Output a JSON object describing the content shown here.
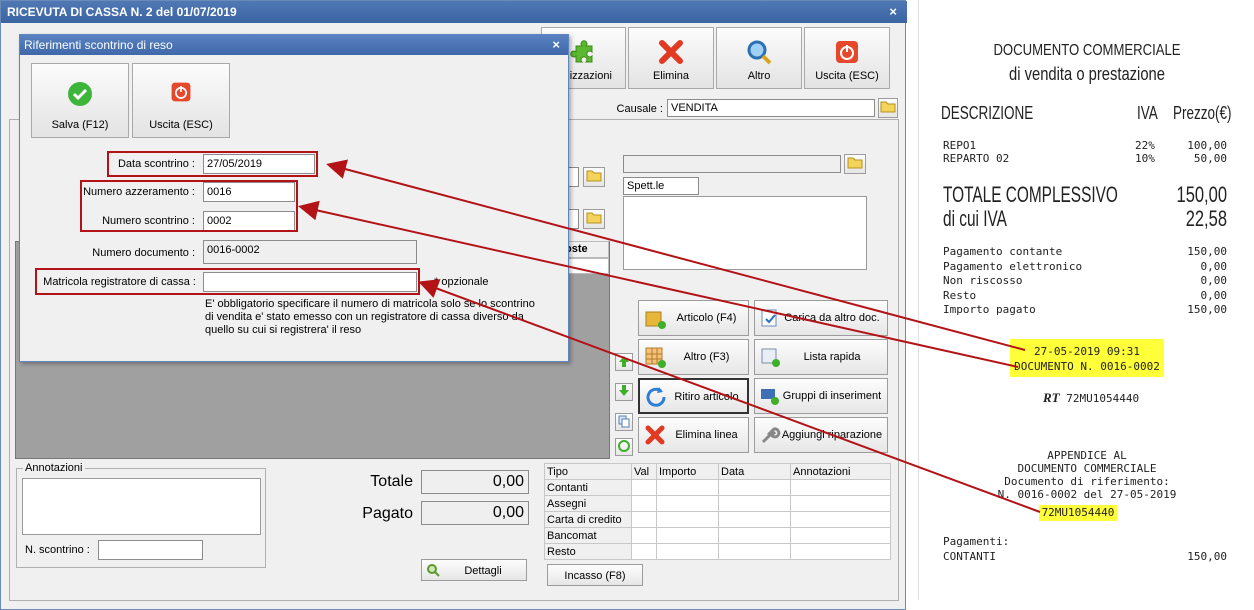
{
  "window": {
    "title": "RICEVUTA DI CASSA N. 2 del 01/07/2019",
    "close": "×"
  },
  "toolbar": {
    "personalizzazioni": "nalizzazioni",
    "elimina": "Elimina",
    "altro": "Altro",
    "uscita": "Uscita (ESC)"
  },
  "causale": {
    "label": "Causale :",
    "value": "VENDITA"
  },
  "customer": {
    "salutation": "Spett.le"
  },
  "grid_header": {
    "costo_fragment": "oste"
  },
  "actions": {
    "articolo": "Articolo (F4)",
    "carica": "Carica da altro doc.",
    "altro": "Altro (F3)",
    "lista": "Lista rapida",
    "ritiro": "Ritiro articolo",
    "gruppi": "Gruppi di inseriment",
    "elimina_linea": "Elimina linea",
    "aggiungi": "Aggiungi riparazione"
  },
  "annotations": {
    "label": "Annotazioni",
    "scontrino_label": "N. scontrino :"
  },
  "totals": {
    "totale_label": "Totale",
    "totale_value": "0,00",
    "pagato_label": "Pagato",
    "pagato_value": "0,00",
    "dettagli": "Dettagli",
    "incasso": "Incasso (F8)"
  },
  "payments": {
    "headers": [
      "Tipo",
      "Val",
      "Importo",
      "Data",
      "Annotazioni"
    ],
    "rows": [
      "Contanti",
      "Assegni",
      "Carta di credito",
      "Bancomat",
      "Resto"
    ]
  },
  "dialog": {
    "title": "Riferimenti scontrino di reso",
    "close": "×",
    "salva": "Salva (F12)",
    "uscita": "Uscita (ESC)",
    "data_label": "Data scontrino :",
    "data_value": "27/05/2019",
    "azzeramento_label": "Numero azzeramento :",
    "azzeramento_value": "0016",
    "scontrino_label": "Numero scontrino :",
    "scontrino_value": "0002",
    "documento_label": "Numero documento :",
    "documento_value": "0016-0002",
    "matricola_label": "Matricola registratore di cassa :",
    "matricola_value": "",
    "optional": "* opzionale",
    "note": [
      "E' obbligatorio specificare il numero di matricola solo se lo scontrino",
      "di vendita e' stato emesso con un registratore di cassa diverso da",
      "quello su cui si registrera' il reso"
    ]
  },
  "receipt": {
    "title1": "DOCUMENTO COMMERCIALE",
    "title2": "di vendita o prestazione",
    "h_desc": "DESCRIZIONE",
    "h_iva": "IVA",
    "h_prezzo": "Prezzo(€)",
    "items": [
      {
        "desc": "REPO1",
        "iva": "22%",
        "price": "100,00"
      },
      {
        "desc": "REPARTO 02",
        "iva": "10%",
        "price": "50,00"
      }
    ],
    "totale_label": "TOTALE COMPLESSIVO",
    "totale_value": "150,00",
    "iva_label": "di cui IVA",
    "iva_value": "22,58",
    "payments": [
      {
        "l": "Pagamento contante",
        "v": "150,00"
      },
      {
        "l": "Pagamento elettronico",
        "v": "0,00"
      },
      {
        "l": "Non riscosso",
        "v": "0,00"
      },
      {
        "l": "Resto",
        "v": "0,00"
      },
      {
        "l": "Importo pagato",
        "v": "150,00"
      }
    ],
    "datetime": "27-05-2019  09:31",
    "docnum": "DOCUMENTO N. 0016-0002",
    "rt": "72MU1054440",
    "app1": "APPENDICE AL",
    "app2": "DOCUMENTO COMMERCIALE",
    "app3": "Documento di riferimento:",
    "app4": "N. 0016-0002 del 27-05-2019",
    "app5": "72MU1054440",
    "pag_label": "Pagamenti:",
    "contanti": "CONTANTI",
    "contanti_value": "150,00"
  },
  "colors": {
    "accent_red": "#b31217",
    "title_blue": "#3b64a3",
    "highlight": "#ffff3a"
  }
}
